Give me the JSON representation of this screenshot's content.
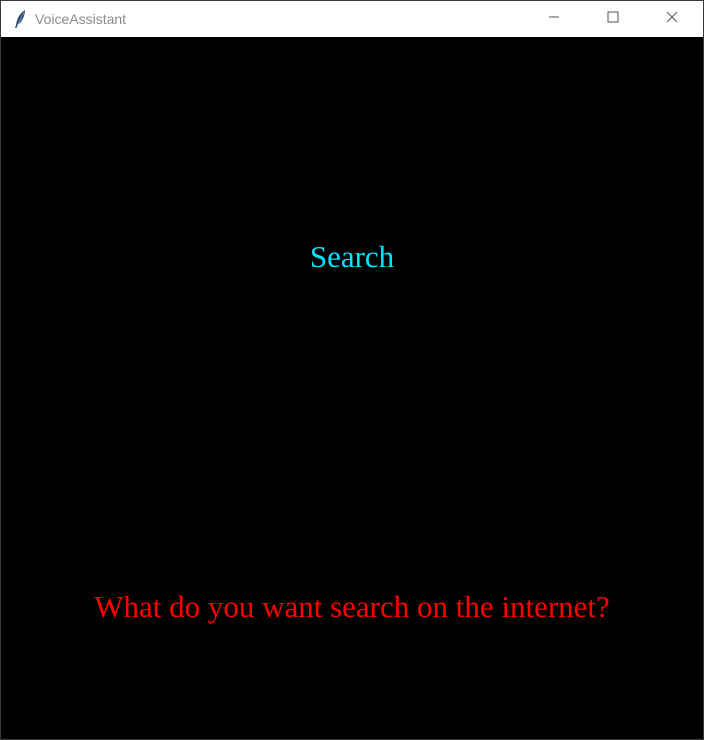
{
  "window": {
    "title": "VoiceAssistant",
    "icon": "feather-icon",
    "controls": {
      "minimize_icon": "minimize-icon",
      "maximize_icon": "maximize-icon",
      "close_icon": "close-icon"
    }
  },
  "content": {
    "heading": "Search",
    "prompt": "What do you want search on the internet?"
  },
  "colors": {
    "background": "#000000",
    "heading": "#00e5ff",
    "prompt": "#ff0000",
    "titlebar": "#ffffff"
  }
}
